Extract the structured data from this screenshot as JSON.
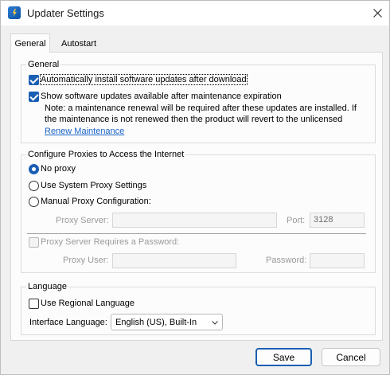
{
  "window": {
    "title": "Updater Settings",
    "app_icon": "updater-app-icon",
    "close_icon": "close-icon"
  },
  "tabs": [
    {
      "label": "General",
      "active": true
    },
    {
      "label": "Autostart",
      "active": false
    }
  ],
  "general_group": {
    "label": "General",
    "auto_install": {
      "label": "Automatically install software updates after download",
      "checked": true
    },
    "show_expired": {
      "label": "Show software updates available after maintenance expiration",
      "checked": true
    },
    "note_line1": "Note: a maintenance renewal will be required after these updates are installed. If",
    "note_line2": "the maintenance is not renewed then the product will revert to the unlicensed",
    "renew_link": "Renew Maintenance"
  },
  "proxy_group": {
    "label": "Configure Proxies to Access the Internet",
    "options": [
      {
        "label": "No proxy",
        "checked": true
      },
      {
        "label": "Use System Proxy Settings",
        "checked": false
      },
      {
        "label": "Manual Proxy Configuration:",
        "checked": false
      }
    ],
    "proxy_server_label": "Proxy Server:",
    "proxy_server_value": "",
    "port_label": "Port:",
    "port_value": "3128",
    "requires_password": {
      "label": "Proxy Server Requires a Password:",
      "checked": false
    },
    "proxy_user_label": "Proxy User:",
    "proxy_user_value": "",
    "password_label": "Password:",
    "password_value": ""
  },
  "language_group": {
    "label": "Language",
    "use_regional": {
      "label": "Use Regional Language",
      "checked": false
    },
    "interface_language_label": "Interface Language:",
    "interface_language_value": "English (US), Built-In"
  },
  "buttons": {
    "save": "Save",
    "cancel": "Cancel"
  },
  "colors": {
    "accent": "#1a5fb4",
    "link": "#1a63c6",
    "disabled_text": "#9a9a9a"
  }
}
